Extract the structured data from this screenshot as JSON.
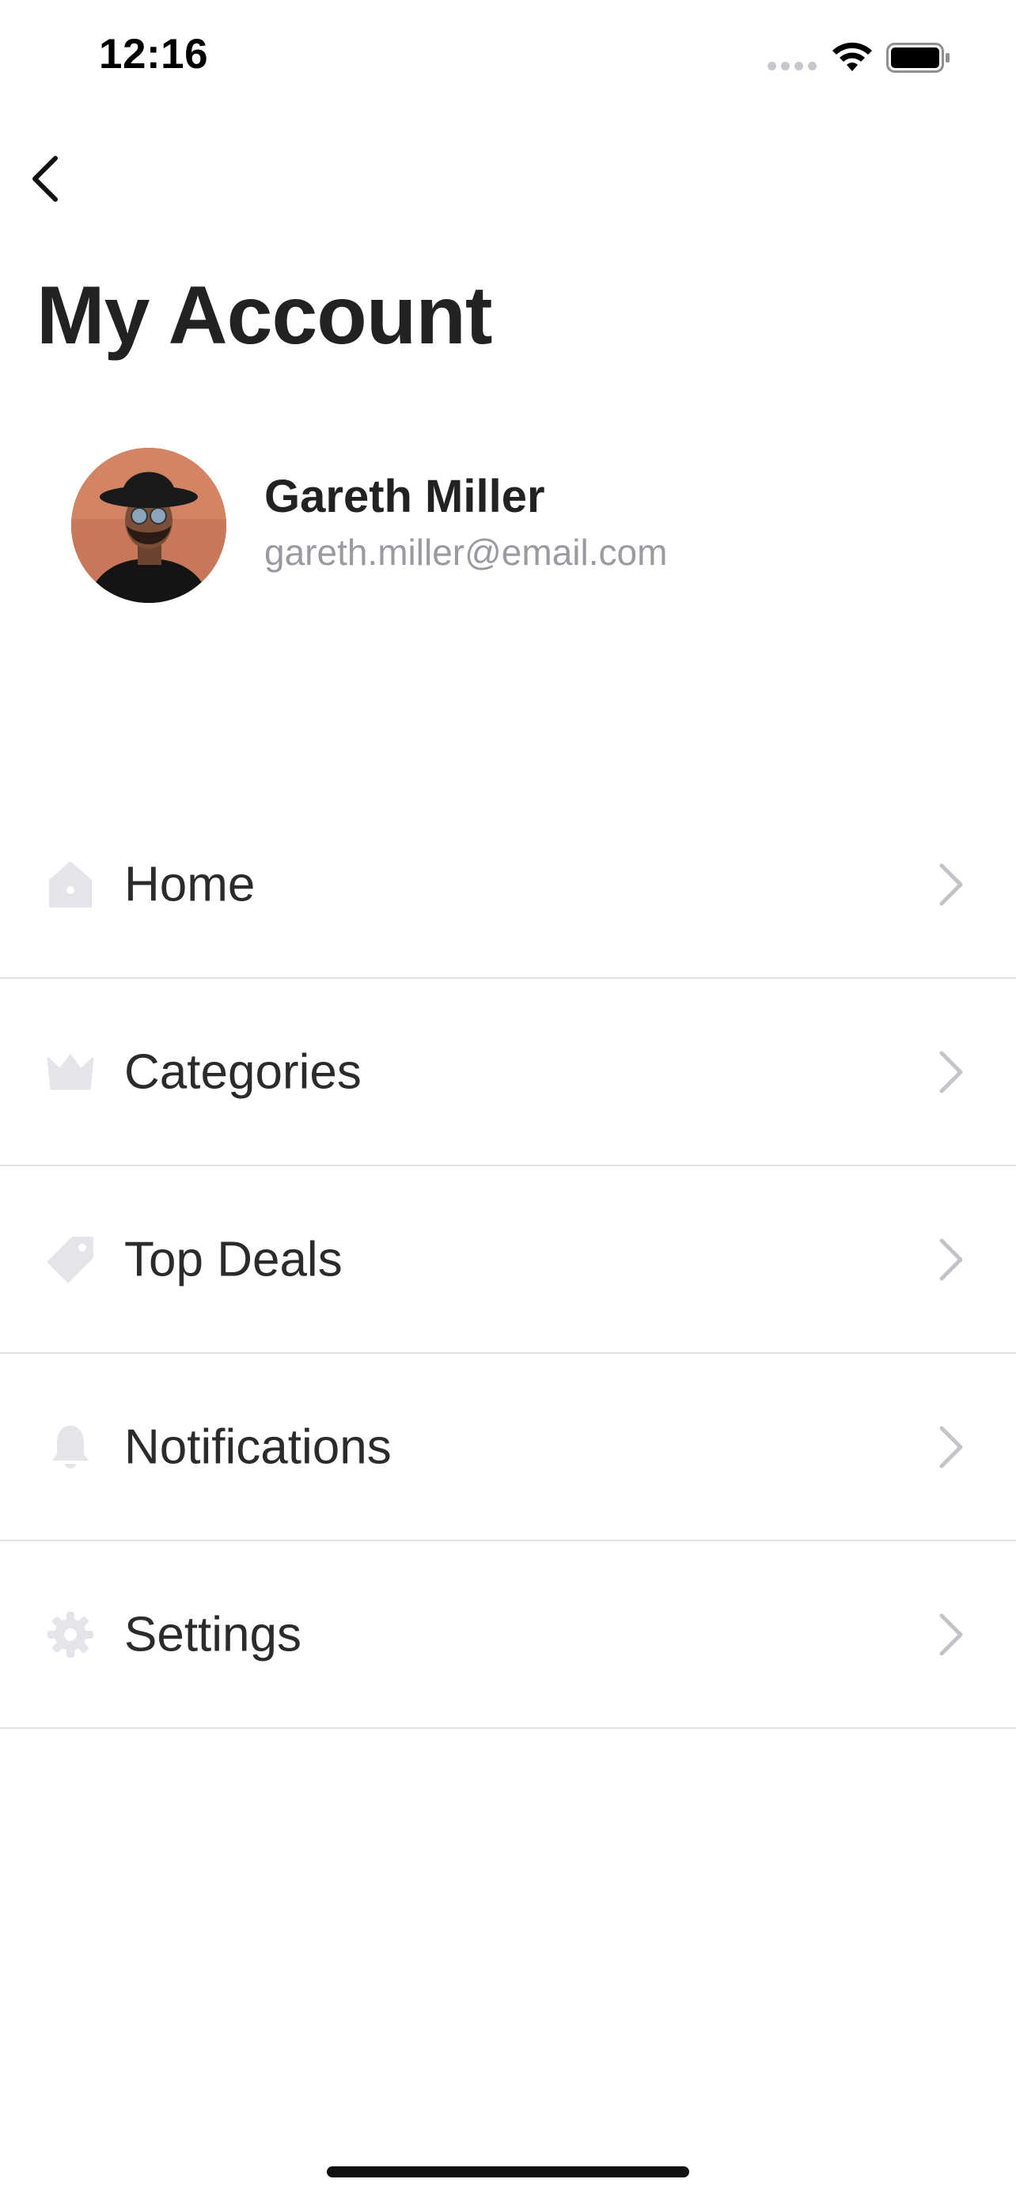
{
  "status_bar": {
    "time": "12:16",
    "icons": [
      "signal-icon",
      "wifi-icon",
      "battery-icon"
    ]
  },
  "nav": {
    "back_icon": "chevron-left-icon"
  },
  "page": {
    "title": "My Account"
  },
  "profile": {
    "name": "Gareth Miller",
    "email": "gareth.miller@email.com"
  },
  "menu": {
    "items": [
      {
        "label": "Home",
        "icon": "home-icon"
      },
      {
        "label": "Categories",
        "icon": "crown-icon"
      },
      {
        "label": "Top Deals",
        "icon": "tag-icon"
      },
      {
        "label": "Notifications",
        "icon": "bell-icon"
      },
      {
        "label": "Settings",
        "icon": "gear-icon"
      }
    ],
    "chevron_icon": "chevron-right-icon"
  },
  "colors": {
    "text_primary": "#222222",
    "text_secondary": "#9a9aa0",
    "icon_muted": "#e4e4ea",
    "divider": "#e1e1e4",
    "chevron": "#c4c4c8"
  }
}
